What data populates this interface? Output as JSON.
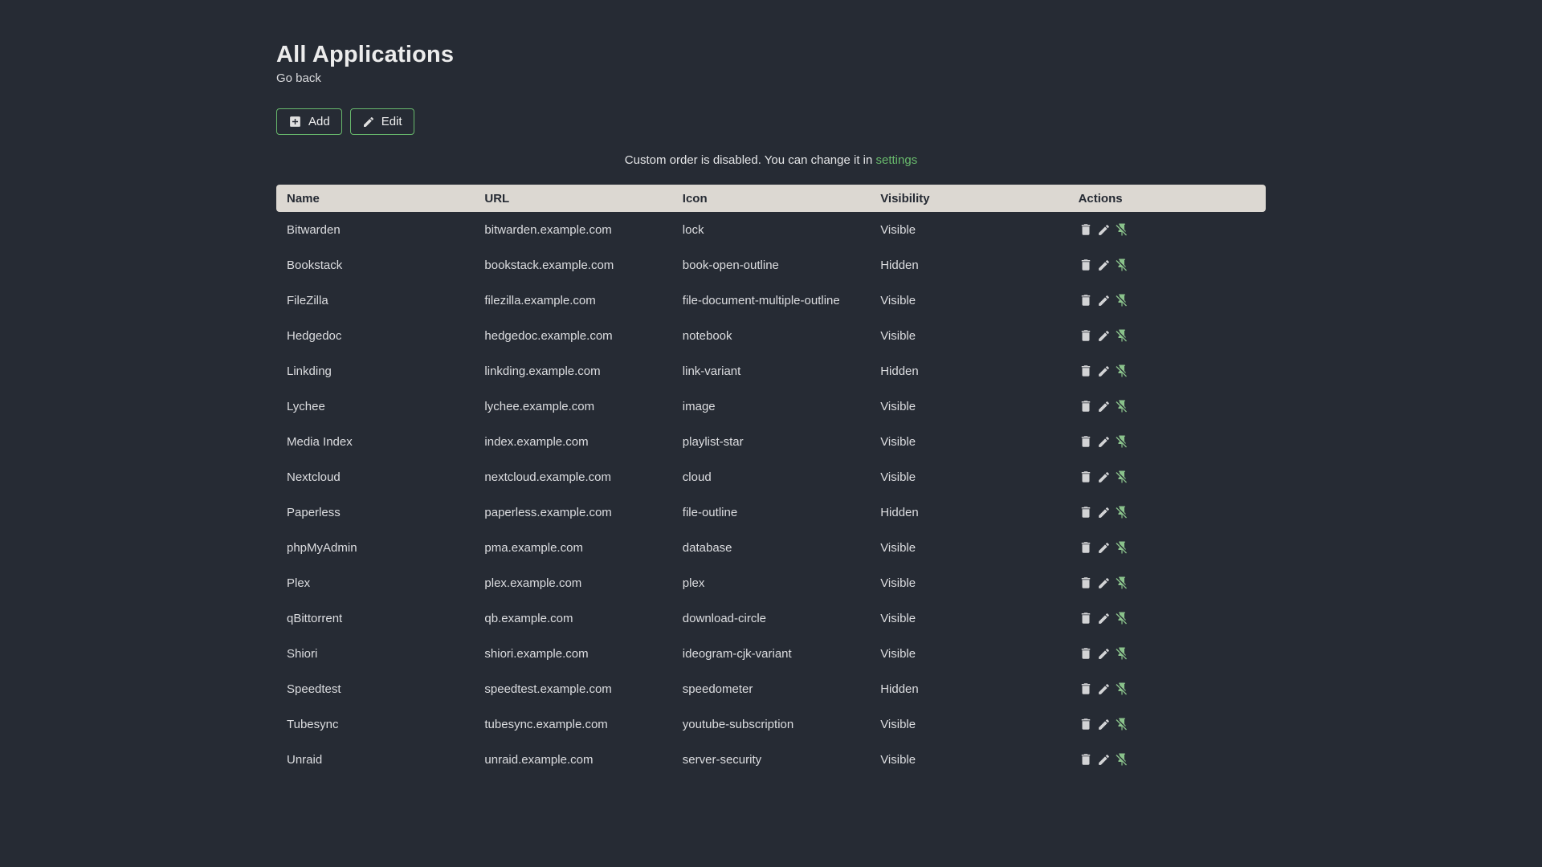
{
  "page": {
    "title": "All Applications",
    "go_back_label": "Go back",
    "notice_text": "Custom order is disabled. You can change it in",
    "notice_link_label": "settings"
  },
  "toolbar": {
    "add_label": "Add",
    "edit_label": "Edit"
  },
  "icons": {
    "add_button": "plus-box-icon",
    "edit_button": "pencil-icon",
    "row_delete": "trash-icon",
    "row_edit": "pencil-icon",
    "row_visibility": "pin-off-icon"
  },
  "colors": {
    "page_background": "#262b34",
    "table_header_background": "#dcd8d2",
    "table_header_text": "#252a33",
    "accent_green": "#68b96c",
    "icon_green": "#8ac28b",
    "light_icon": "#d2d3d5"
  },
  "table": {
    "columns": [
      "Name",
      "URL",
      "Icon",
      "Visibility",
      "Actions"
    ],
    "rows": [
      {
        "name": "Bitwarden",
        "url": "bitwarden.example.com",
        "icon": "lock",
        "visibility": "Visible"
      },
      {
        "name": "Bookstack",
        "url": "bookstack.example.com",
        "icon": "book-open-outline",
        "visibility": "Hidden"
      },
      {
        "name": "FileZilla",
        "url": "filezilla.example.com",
        "icon": "file-document-multiple-outline",
        "visibility": "Visible"
      },
      {
        "name": "Hedgedoc",
        "url": "hedgedoc.example.com",
        "icon": "notebook",
        "visibility": "Visible"
      },
      {
        "name": "Linkding",
        "url": "linkding.example.com",
        "icon": "link-variant",
        "visibility": "Hidden"
      },
      {
        "name": "Lychee",
        "url": "lychee.example.com",
        "icon": "image",
        "visibility": "Visible"
      },
      {
        "name": "Media Index",
        "url": "index.example.com",
        "icon": "playlist-star",
        "visibility": "Visible"
      },
      {
        "name": "Nextcloud",
        "url": "nextcloud.example.com",
        "icon": "cloud",
        "visibility": "Visible"
      },
      {
        "name": "Paperless",
        "url": "paperless.example.com",
        "icon": "file-outline",
        "visibility": "Hidden"
      },
      {
        "name": "phpMyAdmin",
        "url": "pma.example.com",
        "icon": "database",
        "visibility": "Visible"
      },
      {
        "name": "Plex",
        "url": "plex.example.com",
        "icon": "plex",
        "visibility": "Visible"
      },
      {
        "name": "qBittorrent",
        "url": "qb.example.com",
        "icon": "download-circle",
        "visibility": "Visible"
      },
      {
        "name": "Shiori",
        "url": "shiori.example.com",
        "icon": "ideogram-cjk-variant",
        "visibility": "Visible"
      },
      {
        "name": "Speedtest",
        "url": "speedtest.example.com",
        "icon": "speedometer",
        "visibility": "Hidden"
      },
      {
        "name": "Tubesync",
        "url": "tubesync.example.com",
        "icon": "youtube-subscription",
        "visibility": "Visible"
      },
      {
        "name": "Unraid",
        "url": "unraid.example.com",
        "icon": "server-security",
        "visibility": "Visible"
      }
    ]
  }
}
